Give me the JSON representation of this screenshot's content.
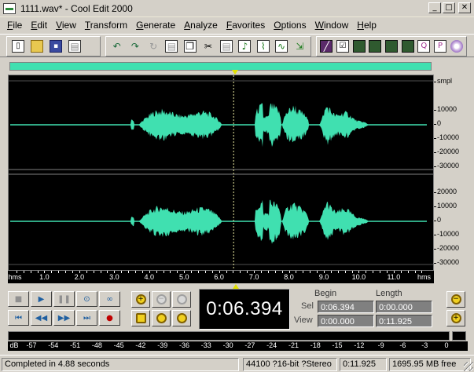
{
  "window": {
    "title": "1111.wav* - Cool Edit 2000"
  },
  "menu": [
    {
      "label": "File",
      "key": "F",
      "rest": "ile"
    },
    {
      "label": "Edit",
      "key": "E",
      "rest": "dit"
    },
    {
      "label": "View",
      "key": "V",
      "rest": "iew"
    },
    {
      "label": "Transform",
      "key": "T",
      "rest": "ransform"
    },
    {
      "label": "Generate",
      "key": "G",
      "rest": "enerate"
    },
    {
      "label": "Analyze",
      "key": "A",
      "rest": "nalyze"
    },
    {
      "label": "Favorites",
      "key": "F",
      "rest": "avorites"
    },
    {
      "label": "Options",
      "key": "O",
      "rest": "ptions"
    },
    {
      "label": "Window",
      "key": "W",
      "rest": "indow"
    },
    {
      "label": "Help",
      "key": "H",
      "rest": "elp"
    }
  ],
  "toolbar": {
    "file": [
      "new-icon",
      "open-icon",
      "save-icon",
      "save-all-icon"
    ],
    "edit": [
      "undo-icon",
      "redo-icon",
      "repeat-icon",
      "copy-new-icon",
      "copy-icon",
      "cut-icon",
      "paste-icon",
      "mix-paste-icon",
      "trim-icon",
      "generate-icon",
      "amplify-icon"
    ],
    "view": [
      "spectral-view-icon",
      "check-icon",
      "view-icon",
      "view-icon",
      "view-icon",
      "view-icon",
      "page-icon",
      "page-icon",
      "cd-icon"
    ]
  },
  "amplitude_ruler": {
    "unit": "smpl",
    "top_channel": [
      "10000",
      "0",
      "-10000",
      "-20000",
      "-30000"
    ],
    "bottom_channel": [
      "20000",
      "10000",
      "0",
      "-10000",
      "-20000",
      "-30000"
    ]
  },
  "time_ruler": {
    "unit": "hms",
    "ticks": [
      "1.0",
      "2.0",
      "3.0",
      "4.0",
      "5.0",
      "6.0",
      "7.0",
      "8.0",
      "9.0",
      "10.0",
      "11.0"
    ],
    "cursor_time": 6.394,
    "total_length": 11.925
  },
  "time_display": "0:06.394",
  "selection_panel": {
    "begin_label": "Begin",
    "length_label": "Length",
    "sel_label": "Sel",
    "view_label": "View",
    "sel_begin": "0:06.394",
    "sel_length": "0:00.000",
    "view_begin": "0:00.000",
    "view_length": "0:11.925"
  },
  "level_meter": {
    "unit": "dB",
    "ticks": [
      "-57",
      "-54",
      "-51",
      "-48",
      "-45",
      "-42",
      "-39",
      "-36",
      "-33",
      "-30",
      "-27",
      "-24",
      "-21",
      "-18",
      "-15",
      "-12",
      "-9",
      "-6",
      "-3",
      "0"
    ]
  },
  "status": {
    "message": "Completed in 4.88 seconds",
    "format": "44100 ?16-bit ?Stereo",
    "length": "0:11.925",
    "free": "1695.95 MB free"
  },
  "colors": {
    "waveform": "#40e0b0",
    "background": "#000000",
    "cursor": "#e0e000"
  }
}
